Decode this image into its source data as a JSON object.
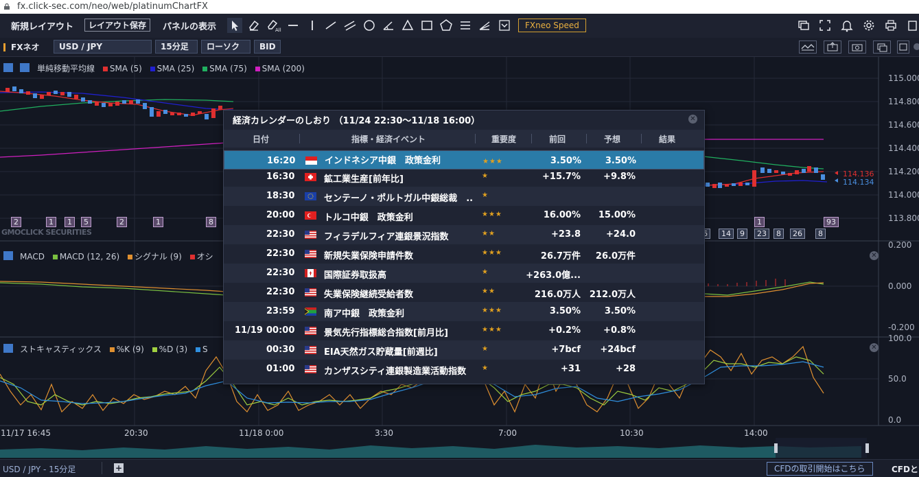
{
  "browser": {
    "url": "fx.click-sec.com/neo/web/platinumChartFX"
  },
  "toolbar": {
    "new_layout": "新規レイアウト",
    "save_layout": "レイアウト保存",
    "panel_display": "パネルの表示",
    "tools": [
      "cursor-icon",
      "eraser-icon",
      "eraser-all-icon",
      "horizontal-line-icon",
      "vertical-line-icon",
      "trend-line-icon",
      "parallel-lines-icon",
      "circle-icon",
      "angle-icon",
      "triangle-icon",
      "rectangle-icon",
      "pentagon-icon",
      "fibonacci-icon",
      "fan-icon",
      "dropdown-icon"
    ],
    "fxneo_speed": "FXneo Speed",
    "right_icons": [
      "window-icon",
      "fullscreen-icon",
      "bell-icon",
      "gear-icon",
      "print-icon",
      "copy-icon"
    ]
  },
  "symbol_bar": {
    "brand": "FXネオ",
    "pair": "USD / JPY",
    "interval": "15分足",
    "chart_type": "ローソク",
    "side": "BID"
  },
  "legend_main": {
    "title": "単純移動平均線",
    "items": [
      {
        "label": "SMA (5)",
        "color": "#e03030"
      },
      {
        "label": "SMA (25)",
        "color": "#2020d0"
      },
      {
        "label": "SMA (75)",
        "color": "#20b060"
      },
      {
        "label": "SMA (200)",
        "color": "#d020c0"
      }
    ]
  },
  "legend_macd": {
    "title": "MACD",
    "items": [
      {
        "label": "MACD (12, 26)",
        "color": "#7ac040"
      },
      {
        "label": "シグナル (9)",
        "color": "#e09030"
      },
      {
        "label": "オシ",
        "color": "#e03030"
      }
    ]
  },
  "legend_stoch": {
    "title": "ストキャスティックス",
    "items": [
      {
        "label": "%K (9)",
        "color": "#e09030"
      },
      {
        "label": "%D (3)",
        "color": "#a0d040"
      },
      {
        "label": "S",
        "color": "#3090e0"
      }
    ]
  },
  "axes": {
    "price_ticks": [
      "115.000",
      "114.800",
      "114.600",
      "114.400",
      "114.200",
      "114.000",
      "113.800"
    ],
    "macd_ticks": [
      "0.200",
      "0.000",
      "-0.200"
    ],
    "stoch_ticks": [
      "100.0",
      "50.0",
      "0.0"
    ],
    "time_ticks": [
      "11/17 16:45",
      "20:30",
      "11/18 0:00",
      "3:30",
      "7:00",
      "10:30",
      "14:00"
    ],
    "price_tag_red": "114.136",
    "price_tag_blue": "114.134",
    "red_tag_color": "#e03030",
    "blue_tag_color": "#4a8fe0"
  },
  "watermark": "GMOCLICK SECURITIES",
  "event_counts_left": [
    "2",
    "1",
    "1",
    "5",
    "2",
    "1",
    "8"
  ],
  "event_counts_right_top": [
    "1",
    "93"
  ],
  "event_counts_right_bottom": [
    "6",
    "14",
    "9",
    "23",
    "8",
    "26",
    "8"
  ],
  "calendar": {
    "title": "経済カレンダーのしおり （11/24 22:30～11/18 16:00）",
    "headers": {
      "date": "日付",
      "event": "指標・経済イベント",
      "importance": "重要度",
      "previous": "前回",
      "forecast": "予想",
      "result": "結果"
    },
    "rows": [
      {
        "date": "",
        "time": "16:20",
        "flag": "indonesia",
        "event": "インドネシア中銀　政策金利",
        "stars": "★★★",
        "previous": "3.50%",
        "forecast": "3.50%"
      },
      {
        "date": "",
        "time": "16:30",
        "flag": "switzerland",
        "event": "鉱工業生産[前年比]",
        "stars": "★",
        "previous": "+15.7%",
        "forecast": "+9.8%"
      },
      {
        "date": "",
        "time": "18:30",
        "flag": "eu",
        "event": "センテーノ・ポルトガル中銀総裁　...",
        "stars": "★",
        "previous": "",
        "forecast": ""
      },
      {
        "date": "",
        "time": "20:00",
        "flag": "turkey",
        "event": "トルコ中銀　政策金利",
        "stars": "★★★",
        "previous": "16.00%",
        "forecast": "15.00%"
      },
      {
        "date": "",
        "time": "22:30",
        "flag": "usa",
        "event": "フィラデルフィア連銀景況指数",
        "stars": "★★",
        "previous": "+23.8",
        "forecast": "+24.0"
      },
      {
        "date": "",
        "time": "22:30",
        "flag": "usa",
        "event": "新規失業保険申請件数",
        "stars": "★★★",
        "previous": "26.7万件",
        "forecast": "26.0万件"
      },
      {
        "date": "",
        "time": "22:30",
        "flag": "canada",
        "event": "国際証券取扱高",
        "stars": "★",
        "previous": "+263.0億...",
        "forecast": ""
      },
      {
        "date": "",
        "time": "22:30",
        "flag": "usa",
        "event": "失業保険継続受給者数",
        "stars": "★★",
        "previous": "216.0万人",
        "forecast": "212.0万人"
      },
      {
        "date": "",
        "time": "23:59",
        "flag": "south-africa",
        "event": "南ア中銀　政策金利",
        "stars": "★★★",
        "previous": "3.50%",
        "forecast": "3.50%"
      },
      {
        "date": "11/19",
        "time": "00:00",
        "flag": "usa",
        "event": "景気先行指標総合指数[前月比]",
        "stars": "★★★",
        "previous": "+0.2%",
        "forecast": "+0.8%"
      },
      {
        "date": "",
        "time": "00:30",
        "flag": "usa",
        "event": "EIA天然ガス貯蔵量[前週比]",
        "stars": "★",
        "previous": "+7bcf",
        "forecast": "+24bcf"
      },
      {
        "date": "",
        "time": "01:00",
        "flag": "usa",
        "event": "カンザスシティ連銀製造業活動指数",
        "stars": "★",
        "previous": "+31",
        "forecast": "+28"
      }
    ]
  },
  "status": {
    "symbol": "USD / JPY - 15分足",
    "cfd_button": "CFDの取引開始はこちら",
    "cfd_text": "CFDと"
  },
  "colors": {
    "background": "#131722",
    "selected_row": "#2a7ba8",
    "star": "#e0a020",
    "accent": "#e9a030"
  }
}
